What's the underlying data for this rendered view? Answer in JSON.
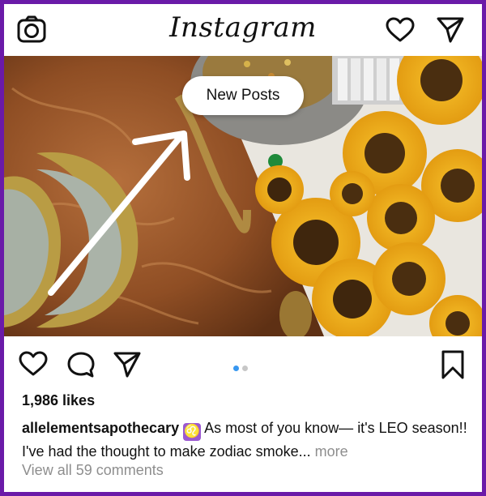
{
  "header": {
    "brand": "Instagram",
    "camera_icon": "camera-icon",
    "activity_icon": "heart-icon",
    "direct_icon": "paper-plane-icon"
  },
  "post": {
    "new_posts_label": "New Posts",
    "carousel": {
      "current": 1,
      "total": 2
    },
    "likes": "1,986 likes",
    "username": "allelementsapothecary",
    "zodiac_symbol": "♌",
    "caption_text": " As most of you know— it's LEO season!! I've had the thought to make zodiac smoke...",
    "more_label": "more",
    "view_comments": "View all 59 comments"
  },
  "actions": {
    "like_icon": "heart-outline-icon",
    "comment_icon": "comment-bubble-icon",
    "share_icon": "paper-plane-icon",
    "save_icon": "bookmark-icon"
  },
  "colors": {
    "frame_border": "#6a1aa8",
    "active_dot": "#3897f0",
    "inactive_dot": "#c7c7c7",
    "muted_text": "#8e8e8e"
  }
}
